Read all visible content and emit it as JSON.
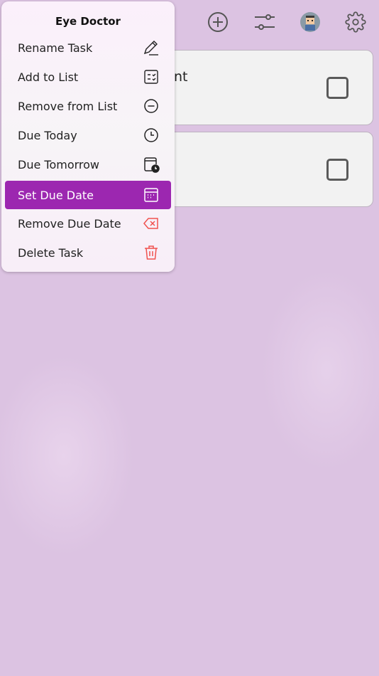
{
  "menu": {
    "title": "Eye Doctor",
    "items": [
      {
        "label": "Rename Task",
        "icon": "pencil-icon"
      },
      {
        "label": "Add to List",
        "icon": "checklist-icon"
      },
      {
        "label": "Remove from List",
        "icon": "minus-circle-icon"
      },
      {
        "label": "Due Today",
        "icon": "clock-icon"
      },
      {
        "label": "Due Tomorrow",
        "icon": "calendar-clock-icon"
      },
      {
        "label": "Set Due Date",
        "icon": "calendar-icon",
        "selected": true
      },
      {
        "label": "Remove Due Date",
        "icon": "backspace-x-icon"
      },
      {
        "label": "Delete Task",
        "icon": "trash-icon"
      }
    ]
  },
  "tasks": [
    {
      "visible_text": "nt",
      "checked": false
    },
    {
      "visible_text": "",
      "checked": false
    }
  ],
  "colors": {
    "accent": "#9c27b0",
    "danger": "#f0524f",
    "background": "#dcc3e2"
  }
}
